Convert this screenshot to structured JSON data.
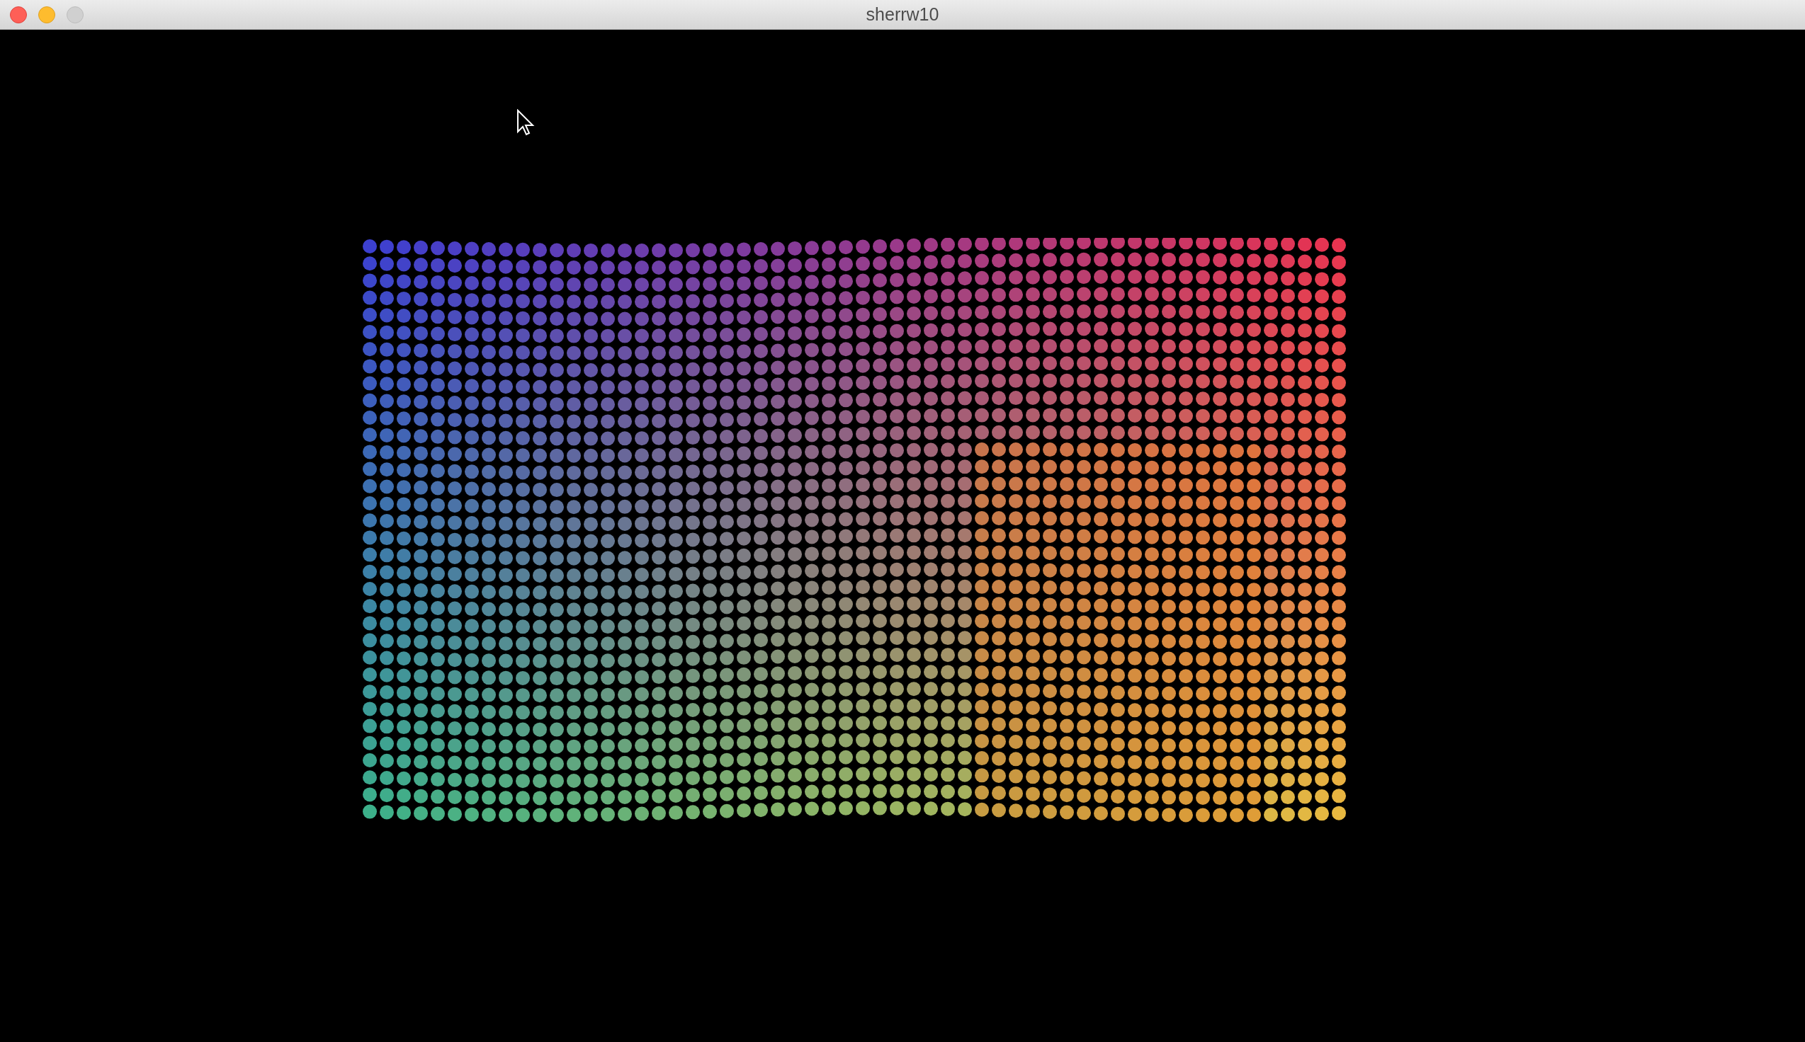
{
  "window": {
    "title": "sherrw10"
  }
}
